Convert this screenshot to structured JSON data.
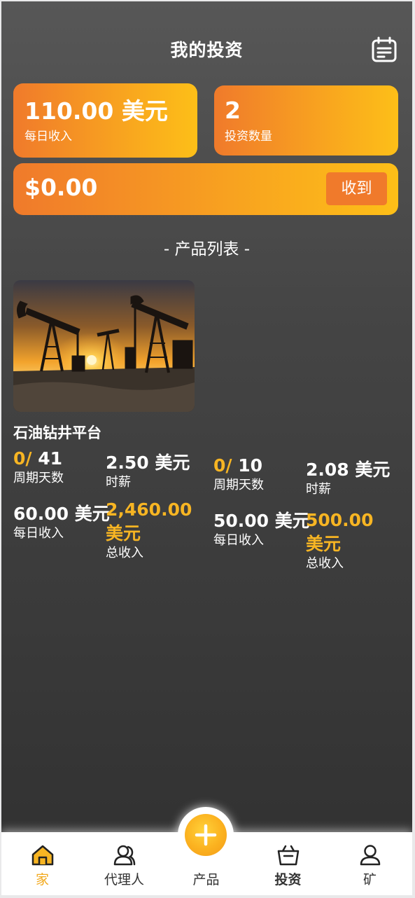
{
  "header": {
    "title": "我的投资",
    "calendar_icon": "calendar-list-icon"
  },
  "summary": {
    "daily_income_value": "110.00 美元",
    "daily_income_label": "每日收入",
    "investment_count_value": "2",
    "investment_count_label": "投资数量",
    "balance_value": "$0.00",
    "receive_button_label": "收到"
  },
  "product_list": {
    "title": "- 产品列表 -",
    "items": [
      {
        "name": "石油钻井平台",
        "image": "oil-pumpjack-sunset-image",
        "cycle_days_done": "0/",
        "cycle_days_total": " 41",
        "cycle_days_label": "周期天数",
        "hourly_value": "2.50 美元",
        "hourly_label": "时薪",
        "daily_value": "60.00 美元",
        "daily_label": "每日收入",
        "total_value": "2,460.00 美元",
        "total_label": "总收入"
      },
      {
        "name": "",
        "image": "",
        "cycle_days_done": "0/",
        "cycle_days_total": " 10",
        "cycle_days_label": "周期天数",
        "hourly_value": "2.08 美元",
        "hourly_label": "时薪",
        "daily_value": "50.00 美元",
        "daily_label": "每日收入",
        "total_value": "500.00 美元",
        "total_label": "总收入"
      }
    ]
  },
  "bottom_nav": {
    "items": [
      {
        "label": "家",
        "icon": "home-icon",
        "active": true
      },
      {
        "label": "代理人",
        "icon": "agent-people-icon",
        "active": false
      },
      {
        "label": "产品",
        "icon": "plus-icon",
        "active": false
      },
      {
        "label": "投资",
        "icon": "basket-icon",
        "active": false
      },
      {
        "label": "矿",
        "icon": "user-icon",
        "active": false
      }
    ]
  },
  "colors": {
    "accent_orange": "#f07a2b",
    "accent_yellow": "#fdbf18",
    "gold_text": "#f7b523",
    "active_nav": "#f2a91d"
  }
}
